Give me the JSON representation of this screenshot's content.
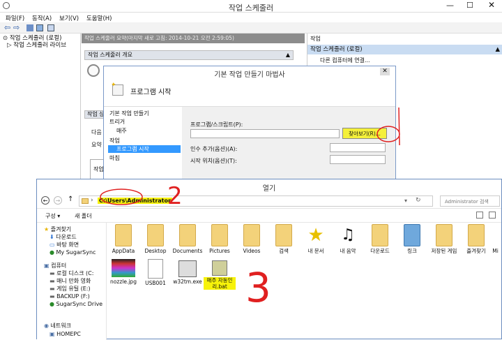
{
  "task_scheduler": {
    "window_title": "작업 스케줄러",
    "menu": [
      "파일(F)",
      "동작(A)",
      "보기(V)",
      "도움말(H)"
    ],
    "tree": [
      "작업 스케줄러 (로컬)",
      "작업 스케줄러 라이브"
    ],
    "center_header": "작업 스케줄러 요약(마지막 새로 고침: 2014-10-21 오전 2:59:05)",
    "overview_title": "작업 스케줄러 개요",
    "side_labels": [
      "작업 상",
      "다음",
      "요약",
      "작업"
    ],
    "actions_header": "작업",
    "actions_selected": "작업 스케줄러 (로컬)",
    "actions_item": "다른 컴퓨터에 연결..."
  },
  "wizard": {
    "title": "기본 작업 만들기 마법사",
    "heading": "프로그램 시작",
    "steps": [
      "기본 작업 만들기",
      "트리거",
      "매주",
      "작업",
      "프로그램 시작",
      "마침"
    ],
    "program_label": "프로그램/스크립트(P):",
    "browse_button": "찾아보기(R)...",
    "args_label": "인수 추가(옵션)(A):",
    "start_label": "시작 위치(옵션)(T):"
  },
  "open_dialog": {
    "title": "열기",
    "address": "C:\\Users\\Administrator",
    "search_placeholder": "Administrator 검색",
    "organize": "구성 ▾",
    "new_folder": "새 폴더",
    "nav_items": [
      "즐겨찾기",
      "다운로드",
      "바탕 화면",
      "My SugarSync",
      "컴퓨터",
      "로컬 디스크 (C:",
      "매니 만화 영화",
      "게임 유틸 (E:)",
      "BACKUP (F:)",
      "SugarSync Drive",
      "네트워크",
      "HOMEPC"
    ],
    "items": [
      "AppData",
      "Desktop",
      "Documents",
      "Pictures",
      "Videos",
      "검색",
      "내 문서",
      "내 음악",
      "다운로드",
      "링크",
      "저장된 게임",
      "즐겨찾기",
      "Mi",
      "nozzle.jpg",
      "USB001",
      "w32tm.exe",
      "매주 자동인리.bat"
    ]
  },
  "annotations": {
    "two": "2",
    "three": "3"
  },
  "colors": {
    "highlight": "#f7f20a",
    "marker": "#e02020",
    "selection": "#3399ff"
  }
}
